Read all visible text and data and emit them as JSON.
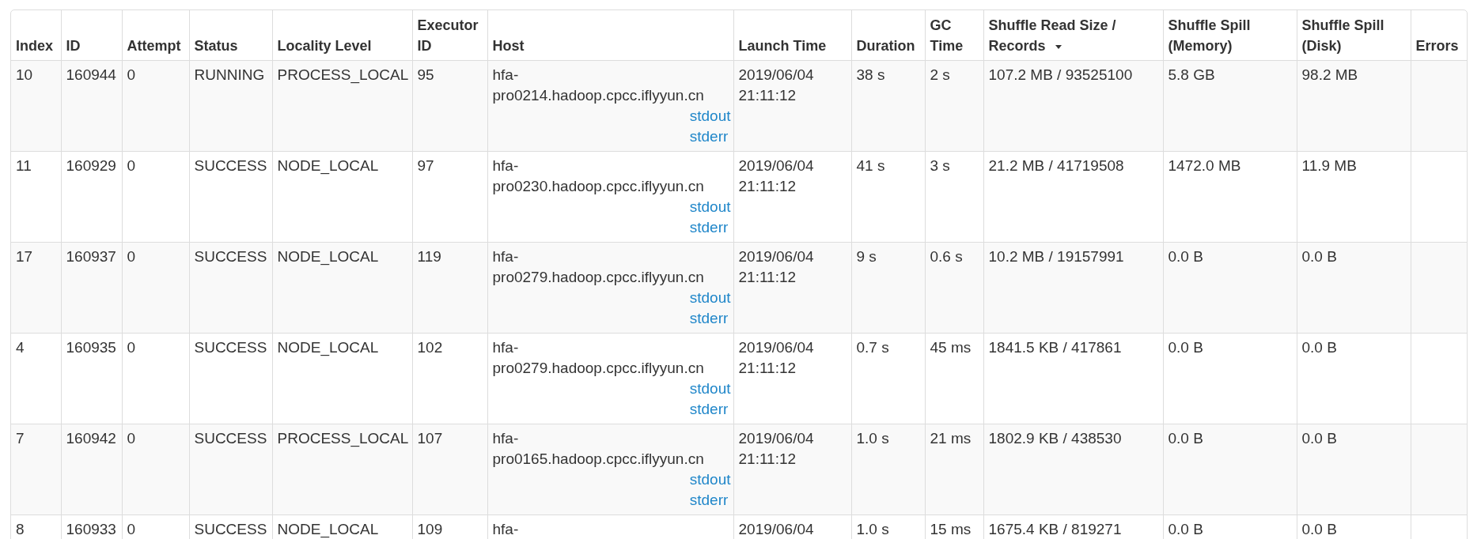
{
  "table": {
    "columns": [
      {
        "label": "Index",
        "sorted": false
      },
      {
        "label": "ID",
        "sorted": false
      },
      {
        "label": "Attempt",
        "sorted": false
      },
      {
        "label": "Status",
        "sorted": false
      },
      {
        "label": "Locality Level",
        "sorted": false
      },
      {
        "label": "Executor ID",
        "sorted": false
      },
      {
        "label": "Host",
        "sorted": false
      },
      {
        "label": "Launch Time",
        "sorted": false
      },
      {
        "label": "Duration",
        "sorted": false
      },
      {
        "label": "GC Time",
        "sorted": false
      },
      {
        "label": "Shuffle Read Size / Records",
        "sorted": true
      },
      {
        "label": "Shuffle Spill (Memory)",
        "sorted": false
      },
      {
        "label": "Shuffle Spill (Disk)",
        "sorted": false
      },
      {
        "label": "Errors",
        "sorted": false
      }
    ],
    "rows": [
      {
        "index": "10",
        "id": "160944",
        "attempt": "0",
        "status": "RUNNING",
        "locality": "PROCESS_LOCAL",
        "executor": "95",
        "host": "hfa-pro0214.hadoop.cpcc.iflyyun.cn",
        "links": [
          "stdout",
          "stderr"
        ],
        "launch": "2019/06/04 21:11:12",
        "duration": "38 s",
        "gc": "2 s",
        "read": "107.2 MB / 93525100",
        "spill_memory": "5.8 GB",
        "spill_disk": "98.2 MB"
      },
      {
        "index": "11",
        "id": "160929",
        "attempt": "0",
        "status": "SUCCESS",
        "locality": "NODE_LOCAL",
        "executor": "97",
        "host": "hfa-pro0230.hadoop.cpcc.iflyyun.cn",
        "links": [
          "stdout",
          "stderr"
        ],
        "launch": "2019/06/04 21:11:12",
        "duration": "41 s",
        "gc": "3 s",
        "read": "21.2 MB / 41719508",
        "spill_memory": "1472.0 MB",
        "spill_disk": "11.9 MB"
      },
      {
        "index": "17",
        "id": "160937",
        "attempt": "0",
        "status": "SUCCESS",
        "locality": "NODE_LOCAL",
        "executor": "119",
        "host": "hfa-pro0279.hadoop.cpcc.iflyyun.cn",
        "links": [
          "stdout",
          "stderr"
        ],
        "launch": "2019/06/04 21:11:12",
        "duration": "9 s",
        "gc": "0.6 s",
        "read": "10.2 MB / 19157991",
        "spill_memory": "0.0 B",
        "spill_disk": "0.0 B"
      },
      {
        "index": "4",
        "id": "160935",
        "attempt": "0",
        "status": "SUCCESS",
        "locality": "NODE_LOCAL",
        "executor": "102",
        "host": "hfa-pro0279.hadoop.cpcc.iflyyun.cn",
        "links": [
          "stdout",
          "stderr"
        ],
        "launch": "2019/06/04 21:11:12",
        "duration": "0.7 s",
        "gc": "45 ms",
        "read": "1841.5 KB / 417861",
        "spill_memory": "0.0 B",
        "spill_disk": "0.0 B"
      },
      {
        "index": "7",
        "id": "160942",
        "attempt": "0",
        "status": "SUCCESS",
        "locality": "PROCESS_LOCAL",
        "executor": "107",
        "host": "hfa-pro0165.hadoop.cpcc.iflyyun.cn",
        "links": [
          "stdout",
          "stderr"
        ],
        "launch": "2019/06/04 21:11:12",
        "duration": "1.0 s",
        "gc": "21 ms",
        "read": "1802.9 KB / 438530",
        "spill_memory": "0.0 B",
        "spill_disk": "0.0 B"
      },
      {
        "index": "8",
        "id": "160933",
        "attempt": "0",
        "status": "SUCCESS",
        "locality": "NODE_LOCAL",
        "executor": "109",
        "host": "hfa-",
        "links": [],
        "launch": "2019/06/04",
        "duration": "1.0 s",
        "gc": "15 ms",
        "read": "1675.4 KB / 819271",
        "spill_memory": "0.0 B",
        "spill_disk": "0.0 B"
      }
    ]
  }
}
